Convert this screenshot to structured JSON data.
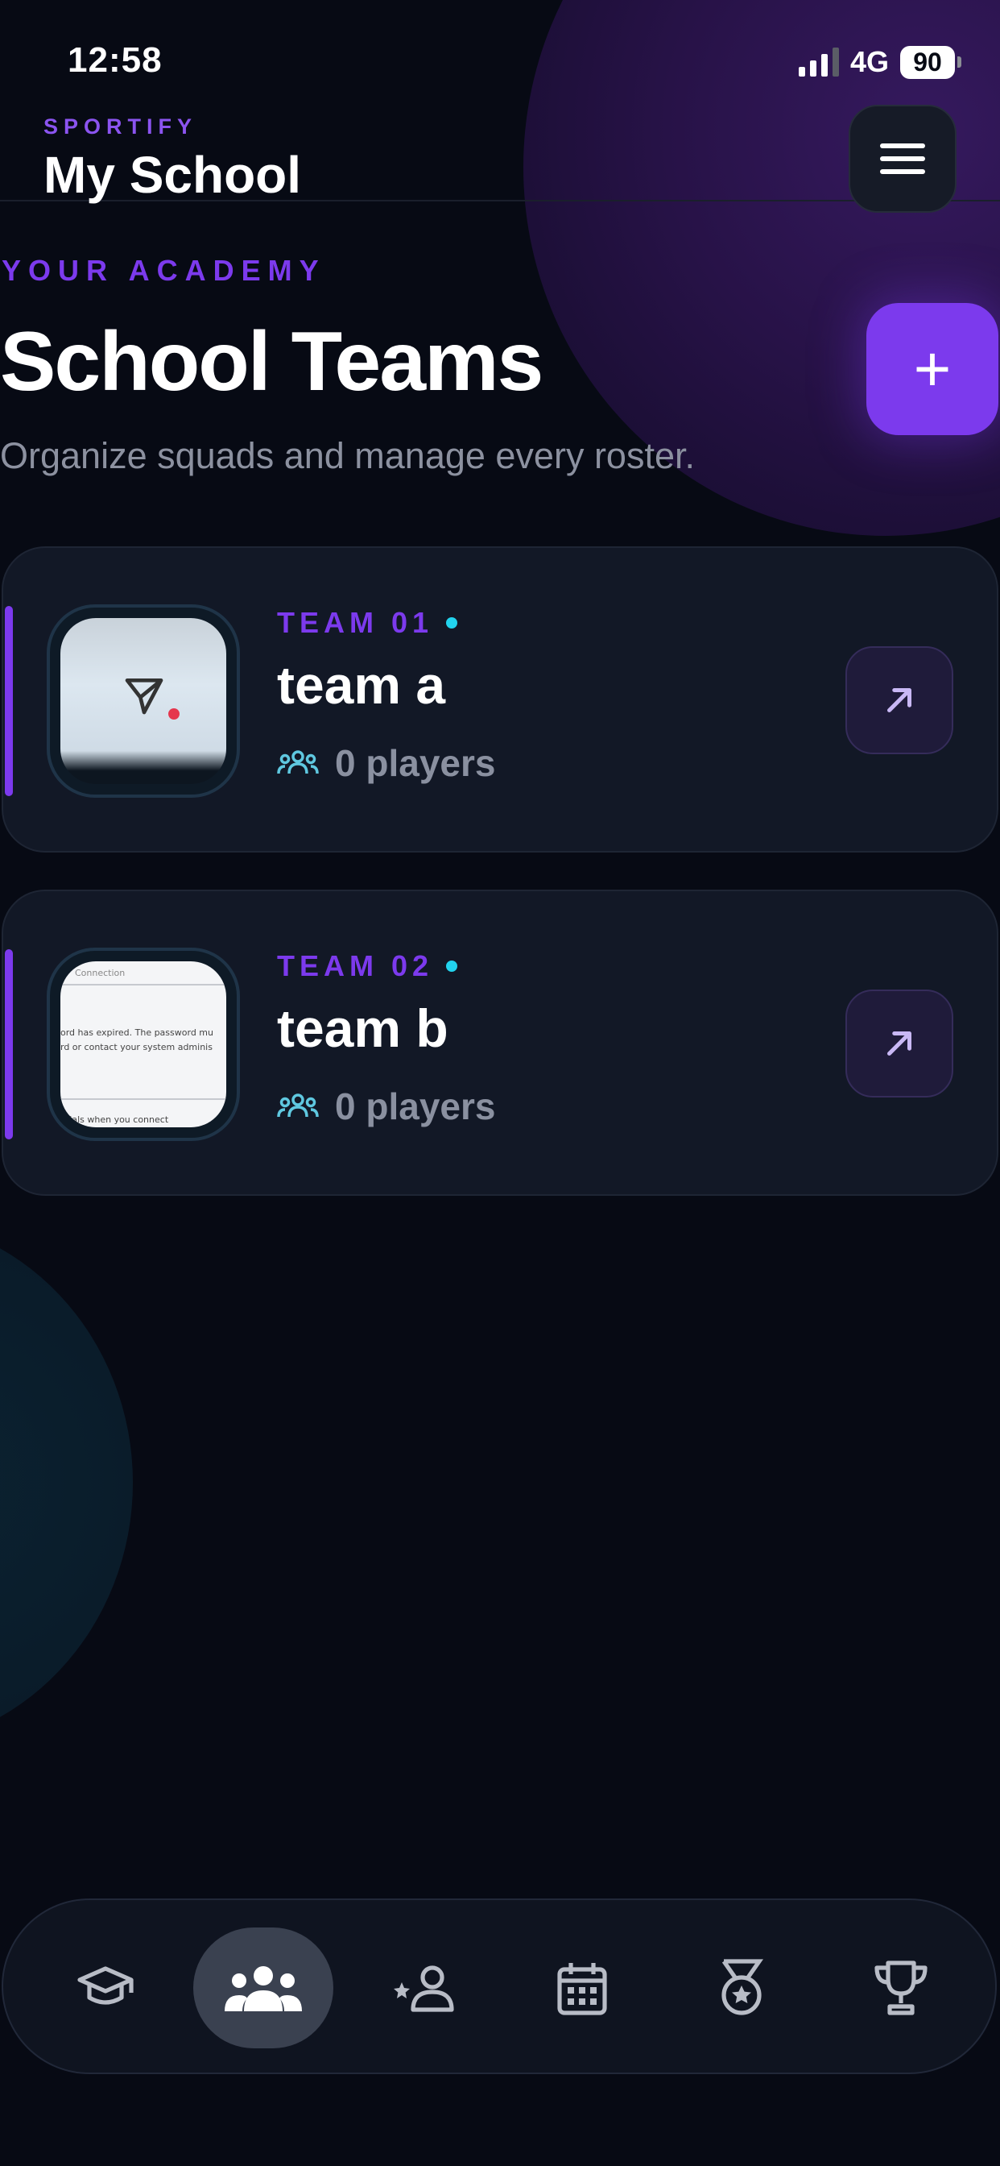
{
  "status_bar": {
    "time": "12:58",
    "network": "4G",
    "battery": "90"
  },
  "header": {
    "brand": "SPORTIFY",
    "title": "My School",
    "menu_icon": "hamburger-menu-icon"
  },
  "hero": {
    "eyebrow": "YOUR ACADEMY",
    "title": "School Teams",
    "subtitle": "Organize squads and manage every roster.",
    "add_label": "+"
  },
  "teams": [
    {
      "label": "TEAM 01",
      "name": "team a",
      "players": "0 players",
      "thumbnail_icon": "send-icon"
    },
    {
      "label": "TEAM 02",
      "name": "team b",
      "players": "0 players",
      "thumbnail_text": [
        "Connection",
        "ord has expired. The password mu",
        "rd or contact your system adminis",
        "ntials when you connect"
      ]
    }
  ],
  "bottom_nav": {
    "items": [
      {
        "icon": "graduation-cap-icon"
      },
      {
        "icon": "users-icon",
        "active": true
      },
      {
        "icon": "star-person-icon"
      },
      {
        "icon": "calendar-icon"
      },
      {
        "icon": "medal-icon"
      },
      {
        "icon": "trophy-icon"
      }
    ]
  },
  "colors": {
    "background": "#070a14",
    "accent": "#7c3aed",
    "live_dot": "#22d3ee",
    "card": "#121826",
    "muted_text": "#8c91a0"
  }
}
